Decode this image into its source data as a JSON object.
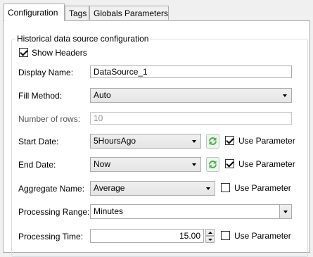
{
  "tabs": [
    {
      "label": "Configuration",
      "active": true
    },
    {
      "label": "Tags",
      "active": false
    },
    {
      "label": "Globals Parameters",
      "active": false
    }
  ],
  "group": {
    "title": "Historical data source configuration"
  },
  "show_headers": {
    "label": "Show Headers",
    "checked": true
  },
  "display_name": {
    "label": "Display Name:",
    "value": "DataSource_1"
  },
  "fill_method": {
    "label": "Fill Method:",
    "value": "Auto"
  },
  "number_of_rows": {
    "label": "Number of rows:",
    "value": "10",
    "enabled": false
  },
  "start_date": {
    "label": "Start Date:",
    "value": "5HoursAgo",
    "use_parameter_label": "Use Parameter",
    "use_parameter": true
  },
  "end_date": {
    "label": "End Date:",
    "value": "Now",
    "use_parameter_label": "Use Parameter",
    "use_parameter": true
  },
  "aggregate_name": {
    "label": "Aggregate Name:",
    "value": "Average",
    "use_parameter_label": "Use Parameter",
    "use_parameter": false
  },
  "processing_range": {
    "label": "Processing Range:",
    "value": "Minutes"
  },
  "processing_time": {
    "label": "Processing Time:",
    "value": "15.00",
    "use_parameter_label": "Use Parameter",
    "use_parameter": false
  },
  "colors": {
    "refresh_icon": "#4caf50",
    "panel_border": "#acacac",
    "group_border": "#d5dfe5"
  },
  "icons": {
    "refresh": "refresh-icon",
    "dropdown": "chevron-down-icon"
  }
}
